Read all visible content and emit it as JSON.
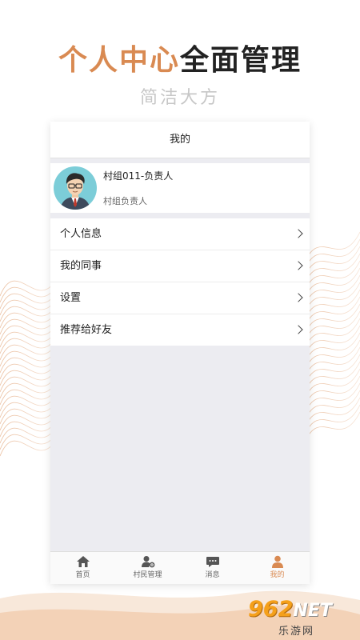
{
  "promo": {
    "headline_accent": "个人中心",
    "headline_dark": "全面管理",
    "subline": "简洁大方"
  },
  "app": {
    "nav_title": "我的",
    "profile": {
      "name": "村组011-负责人",
      "role": "村组负责人"
    },
    "menu": [
      {
        "label": "个人信息",
        "icon": "chevron-right-icon"
      },
      {
        "label": "我的同事",
        "icon": "chevron-right-icon"
      },
      {
        "label": "设置",
        "icon": "chevron-right-icon"
      },
      {
        "label": "推荐给好友",
        "icon": "chevron-right-icon"
      }
    ],
    "tabs": [
      {
        "label": "首页",
        "icon": "home-icon"
      },
      {
        "label": "村民管理",
        "icon": "user-settings-icon"
      },
      {
        "label": "消息",
        "icon": "message-icon"
      },
      {
        "label": "我的",
        "icon": "user-icon",
        "active": true
      }
    ]
  },
  "watermark": {
    "brand": "962",
    "brand_suffix": "NET",
    "site": "乐游网"
  },
  "colors": {
    "accent": "#d98a52",
    "headline_dark": "#222222",
    "subline": "#c7c7c7",
    "content_bg": "#ececf1"
  }
}
